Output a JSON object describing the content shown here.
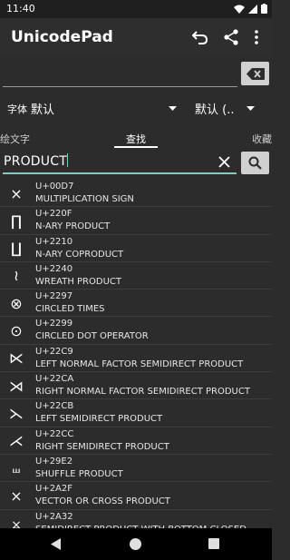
{
  "status_bar": {
    "time": "11:40",
    "icons": [
      "wifi-icon",
      "signal-icon",
      "battery-icon"
    ]
  },
  "app_bar": {
    "title": "UnicodePad",
    "actions": [
      "undo-icon",
      "share-icon",
      "more-vert-icon"
    ]
  },
  "editor": {
    "value": "",
    "backspace_icon": "backspace-icon"
  },
  "font_row": {
    "font_label": "字体",
    "font_value": "默认",
    "style_value": "默认 (.."
  },
  "tabs": {
    "items": [
      {
        "label": "绘文字"
      },
      {
        "label": "查找"
      },
      {
        "label": "收藏"
      }
    ],
    "active": "查找"
  },
  "search": {
    "value": "PRODUCT"
  },
  "results": [
    {
      "glyph": "×",
      "code": "U+00D7",
      "name": "MULTIPLICATION SIGN"
    },
    {
      "glyph": "∏",
      "code": "U+220F",
      "name": "N-ARY PRODUCT"
    },
    {
      "glyph": "∐",
      "code": "U+2210",
      "name": "N-ARY COPRODUCT"
    },
    {
      "glyph": "≀",
      "code": "U+2240",
      "name": "WREATH PRODUCT"
    },
    {
      "glyph": "⊗",
      "code": "U+2297",
      "name": "CIRCLED TIMES"
    },
    {
      "glyph": "⊙",
      "code": "U+2299",
      "name": "CIRCLED DOT OPERATOR"
    },
    {
      "glyph": "⋉",
      "code": "U+22C9",
      "name": "LEFT NORMAL FACTOR SEMIDIRECT PRODUCT"
    },
    {
      "glyph": "⋊",
      "code": "U+22CA",
      "name": "RIGHT NORMAL FACTOR SEMIDIRECT PRODUCT"
    },
    {
      "glyph": "⋋",
      "code": "U+22CB",
      "name": "LEFT SEMIDIRECT PRODUCT"
    },
    {
      "glyph": "⋌",
      "code": "U+22CC",
      "name": "RIGHT SEMIDIRECT PRODUCT"
    },
    {
      "glyph": "⧢",
      "code": "U+29E2",
      "name": "SHUFFLE PRODUCT"
    },
    {
      "glyph": "⨯",
      "code": "U+2A2F",
      "name": "VECTOR OR CROSS PRODUCT"
    },
    {
      "glyph": "⨲",
      "code": "U+2A32",
      "name": "SEMIDIRECT PRODUCT WITH BOTTOM CLOSED"
    }
  ],
  "nav_bar": {
    "icons": [
      "back-icon",
      "home-icon",
      "recents-icon"
    ]
  }
}
